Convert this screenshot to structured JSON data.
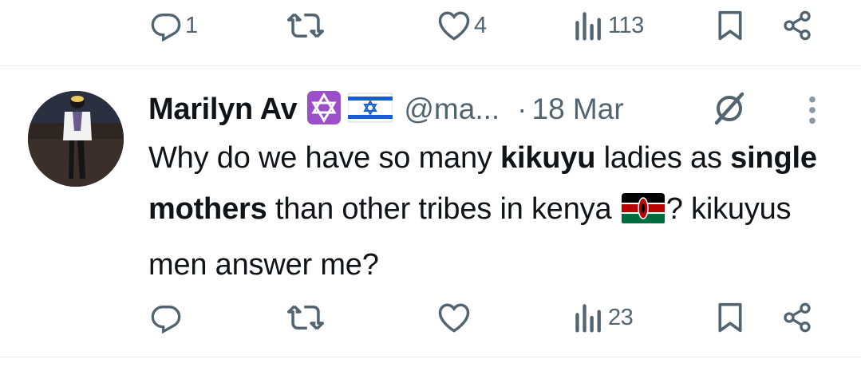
{
  "top_actions": {
    "reply_count": "1",
    "repost_count": "",
    "like_count": "4",
    "views_count": "113"
  },
  "tweet": {
    "display_name": "Marilyn Av",
    "handle": "@ma...",
    "separator": "·",
    "date": "18 Mar",
    "flags": [
      "star-of-david-icon",
      "israel-flag-icon"
    ],
    "text": {
      "p1": "Why do we have so many ",
      "b1": "kikuyu",
      "p2": " ladies as ",
      "b2": "single mothers",
      "p3": " than other tribes in kenya ",
      "p4": "? kikuyus men answer me?"
    },
    "actions": {
      "views_count": "23"
    }
  },
  "colors": {
    "text": "#0f1419",
    "muted": "#536471",
    "divider": "#e6e9eb",
    "star_bg": "#9b4fc8"
  }
}
